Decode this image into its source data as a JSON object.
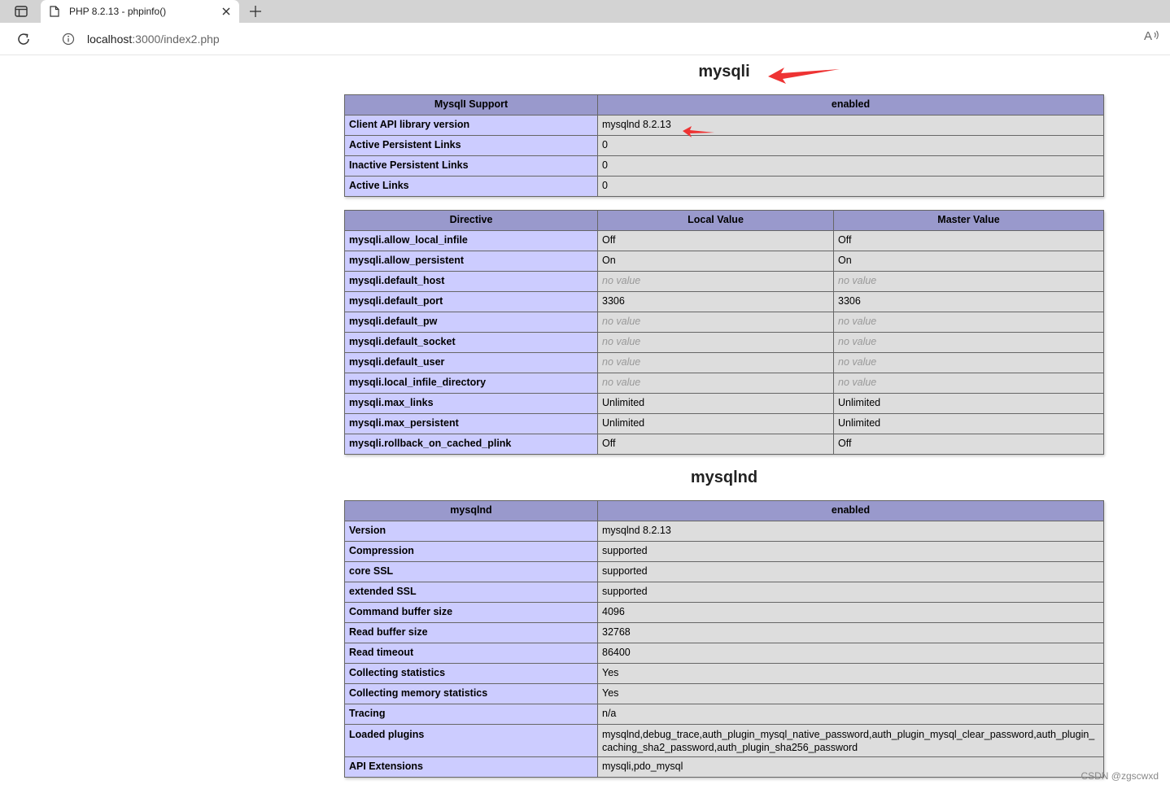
{
  "browser": {
    "tab_title": "PHP 8.2.13 - phpinfo()",
    "url_host": "localhost",
    "url_path": ":3000/index2.php",
    "read_aloud_label": "A",
    "icons": [
      "sidebar-toggle-icon",
      "page-icon",
      "close-icon",
      "plus-icon",
      "reload-icon",
      "info-icon",
      "read-aloud-icon"
    ]
  },
  "mysqli": {
    "heading": "mysqli",
    "support_table": {
      "header": [
        "MysqlI Support",
        "enabled"
      ],
      "rows": [
        [
          "Client API library version",
          "mysqlnd 8.2.13"
        ],
        [
          "Active Persistent Links",
          "0"
        ],
        [
          "Inactive Persistent Links",
          "0"
        ],
        [
          "Active Links",
          "0"
        ]
      ]
    },
    "directive_table": {
      "header": [
        "Directive",
        "Local Value",
        "Master Value"
      ],
      "rows": [
        [
          "mysqli.allow_local_infile",
          "Off",
          "Off"
        ],
        [
          "mysqli.allow_persistent",
          "On",
          "On"
        ],
        [
          "mysqli.default_host",
          "no value",
          "no value"
        ],
        [
          "mysqli.default_port",
          "3306",
          "3306"
        ],
        [
          "mysqli.default_pw",
          "no value",
          "no value"
        ],
        [
          "mysqli.default_socket",
          "no value",
          "no value"
        ],
        [
          "mysqli.default_user",
          "no value",
          "no value"
        ],
        [
          "mysqli.local_infile_directory",
          "no value",
          "no value"
        ],
        [
          "mysqli.max_links",
          "Unlimited",
          "Unlimited"
        ],
        [
          "mysqli.max_persistent",
          "Unlimited",
          "Unlimited"
        ],
        [
          "mysqli.rollback_on_cached_plink",
          "Off",
          "Off"
        ]
      ]
    }
  },
  "mysqlnd": {
    "heading": "mysqlnd",
    "table": {
      "header": [
        "mysqlnd",
        "enabled"
      ],
      "rows": [
        [
          "Version",
          "mysqlnd 8.2.13"
        ],
        [
          "Compression",
          "supported"
        ],
        [
          "core SSL",
          "supported"
        ],
        [
          "extended SSL",
          "supported"
        ],
        [
          "Command buffer size",
          "4096"
        ],
        [
          "Read buffer size",
          "32768"
        ],
        [
          "Read timeout",
          "86400"
        ],
        [
          "Collecting statistics",
          "Yes"
        ],
        [
          "Collecting memory statistics",
          "Yes"
        ],
        [
          "Tracing",
          "n/a"
        ],
        [
          "Loaded plugins",
          "mysqlnd,debug_trace,auth_plugin_mysql_native_password,auth_plugin_mysql_clear_password,auth_plugin_caching_sha2_password,auth_plugin_sha256_password"
        ],
        [
          "API Extensions",
          "mysqli,pdo_mysql"
        ]
      ]
    }
  },
  "annotation_color": "#ee3333",
  "watermark": "CSDN @zgscwxd"
}
